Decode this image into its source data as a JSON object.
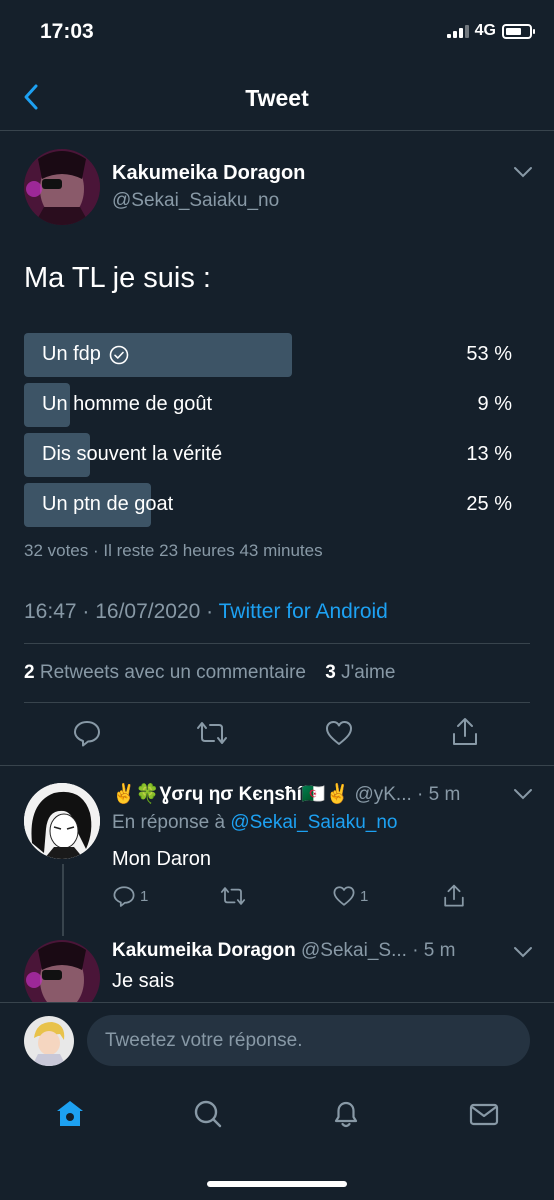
{
  "status_bar": {
    "time": "17:03",
    "network": "4G"
  },
  "header": {
    "title": "Tweet"
  },
  "tweet": {
    "author_name": "Kakumeika Doragon",
    "author_handle": "@Sekai_Saiaku_no",
    "text": "Ma TL je suis :",
    "poll": {
      "options": [
        {
          "label": "Un fdp",
          "percent": "53 %",
          "value": 53,
          "selected": true
        },
        {
          "label": "Un homme de goût",
          "percent": "9 %",
          "value": 9
        },
        {
          "label": "Dis souvent la vérité",
          "percent": "13 %",
          "value": 13
        },
        {
          "label": "Un ptn de goat",
          "percent": "25 %",
          "value": 25
        }
      ],
      "meta": "32 votes · Il reste 23 heures 43 minutes"
    },
    "timestamp": "16:47 · 16/07/2020 · ",
    "source": "Twitter for Android",
    "retweets_count": "2",
    "retweets_label": " Retweets avec un commentaire",
    "likes_count": "3",
    "likes_label": " J'aime"
  },
  "replies": [
    {
      "name": "✌️🍀Ɣσɾɥ ησ Κєηѕħí🇩🇿✌️",
      "handle": "@yK...",
      "time": "· 5 m",
      "reply_to_prefix": "En réponse à ",
      "reply_to_handle": "@Sekai_Saiaku_no",
      "text": "Mon Daron",
      "reply_count": "1",
      "like_count": "1"
    },
    {
      "name": "Kakumeika Doragon",
      "handle": "@Sekai_S...",
      "time": "· 5 m",
      "text": "Je sais"
    }
  ],
  "composer": {
    "placeholder": "Tweetez votre réponse."
  },
  "colors": {
    "background": "#15202b",
    "accent": "#1da1f2",
    "muted": "#8899a6",
    "poll_bar": "#3d5466",
    "divider": "#38444d"
  }
}
